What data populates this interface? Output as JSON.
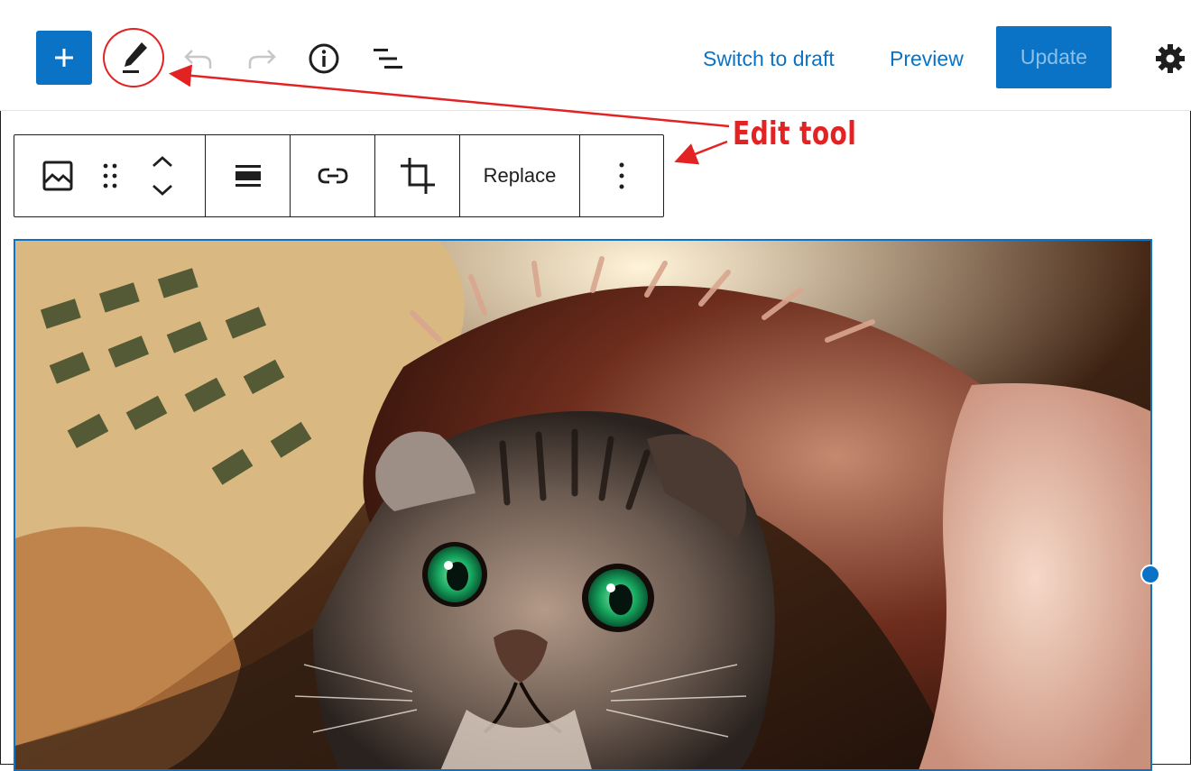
{
  "toolbar": {
    "add_icon": "plus-icon",
    "edit_icon": "pencil-icon",
    "undo_icon": "undo-icon",
    "redo_icon": "redo-icon",
    "info_icon": "info-icon",
    "list_view_icon": "list-view-icon",
    "switch_to_draft_label": "Switch to draft",
    "preview_label": "Preview",
    "update_label": "Update",
    "settings_icon": "gear-icon"
  },
  "block_toolbar": {
    "block_type_icon": "image-icon",
    "drag_icon": "drag-handle-icon",
    "move_icon": "chevron-up-down-icon",
    "align_icon": "align-center-icon",
    "link_icon": "link-icon",
    "crop_icon": "crop-icon",
    "replace_label": "Replace",
    "more_icon": "more-vertical-icon"
  },
  "annotation": {
    "label": "Edit tool"
  },
  "colors": {
    "accent": "#0a73c6",
    "annotation": "#e32323",
    "text": "#1e1e1e",
    "disabled": "#c7c7c7"
  },
  "image": {
    "subject_icon": "cat-photo"
  }
}
